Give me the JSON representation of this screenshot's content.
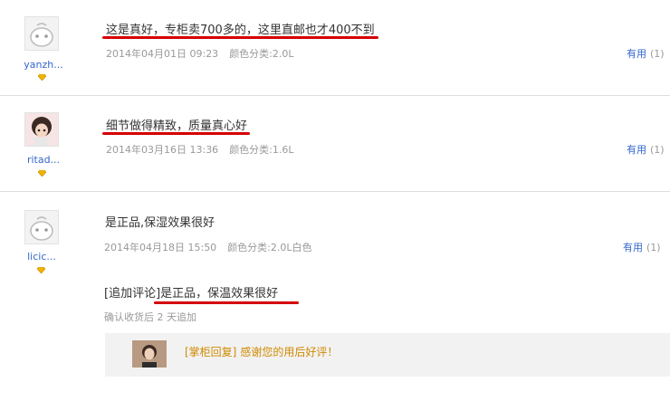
{
  "reviews": [
    {
      "user": "yanzh...",
      "content": "这是真好，专柜卖700多的，这里直邮也才400不到",
      "date": "2014年04月01日 09:23",
      "spec": "颜色分类:2.0L",
      "useful_label": "有用",
      "useful_count": "(1)"
    },
    {
      "user": "ritad...",
      "content": "细节做得精致，质量真心好",
      "date": "2014年03月16日 13:36",
      "spec": "颜色分类:1.6L",
      "useful_label": "有用",
      "useful_count": "(1)"
    },
    {
      "user": "licic...",
      "content": "是正品,保湿效果很好",
      "date": "2014年04月18日 15:50",
      "spec": "颜色分类:2.0L白色",
      "useful_label": "有用",
      "useful_count": "(1)",
      "followup_tag": "[追加评论]",
      "followup_text": "是正品，保温效果很好",
      "followup_after": "确认收货后 2 天追加",
      "reply_tag": "[掌柜回复]",
      "reply_text": "感谢您的用后好评！"
    }
  ],
  "colors": {
    "link": "#3366cc",
    "underline": "#d40000",
    "meta": "#999999",
    "reply": "#d08a00"
  }
}
